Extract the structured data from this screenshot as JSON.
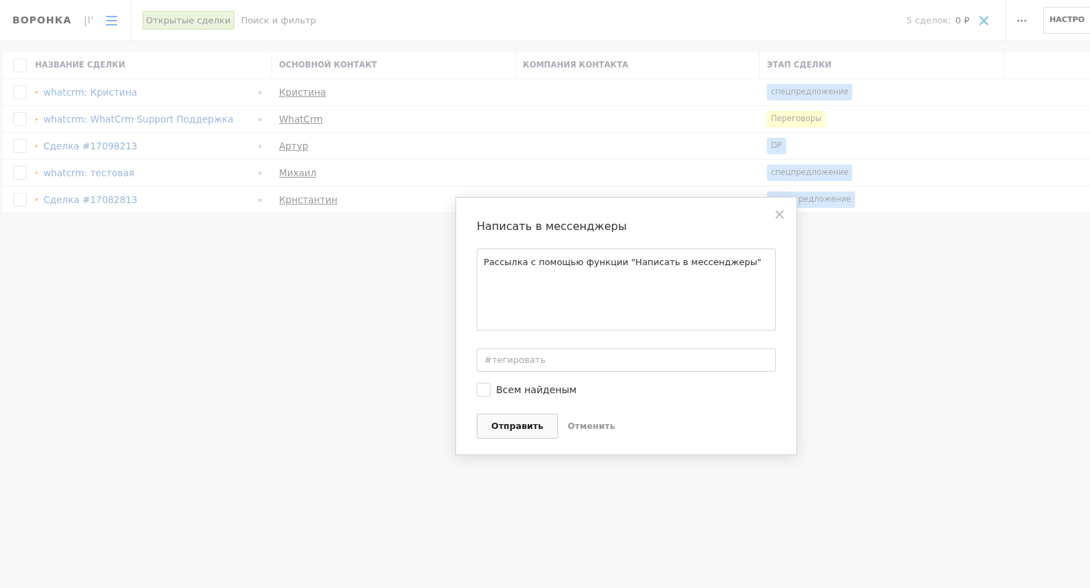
{
  "header": {
    "title": "ВОРОНКА",
    "filter_tag": "Открытые сделки",
    "search": {
      "placeholder": "Поиск и фильтр"
    },
    "summary_label": "5 сделок:",
    "summary_value": "0 ₽",
    "settings_button": "НАСТРО"
  },
  "table": {
    "columns": [
      "НАЗВАНИЕ СДЕЛКИ",
      "ОСНОВНОЙ КОНТАКТ",
      "КОМПАНИЯ КОНТАКТА",
      "ЭТАП СДЕЛКИ"
    ],
    "all_checked": false,
    "rows": [
      {
        "checked": false,
        "name": "whatcrm: Кристина",
        "contact": "Кристина",
        "stage": "спецпредложение",
        "color": "#d6e9fc",
        "stage_covered": false
      },
      {
        "checked": false,
        "name": "whatcrm: WhatCrm Support Поддержка",
        "contact": "WhatCrm",
        "stage": "Переговоры",
        "color": "#ffffd0",
        "stage_covered": false
      },
      {
        "checked": false,
        "name": "Сделка #17098213",
        "contact": "Артур",
        "stage": "DP",
        "color": "#d6e9fc",
        "stage_covered": false
      },
      {
        "checked": false,
        "name": "whatcrm: тестовая",
        "contact": "Михаил",
        "stage": "спецпредложение",
        "color": "#d6e9fc",
        "stage_covered": false
      },
      {
        "checked": false,
        "name": "Сделка #17082813",
        "contact": "Крнстантин",
        "stage": "редложение",
        "color": "#d6e9fc",
        "stage_covered": true
      }
    ]
  },
  "modal": {
    "title": "Написать в мессенджеры",
    "message": "Рассылка с помощью функции \"Написать в мессенджеры\"",
    "tag_placeholder": "#тегировать",
    "all_found": {
      "label": "Всем найденым",
      "checked": false
    },
    "submit": "Отправить",
    "cancel": "Отменить"
  }
}
